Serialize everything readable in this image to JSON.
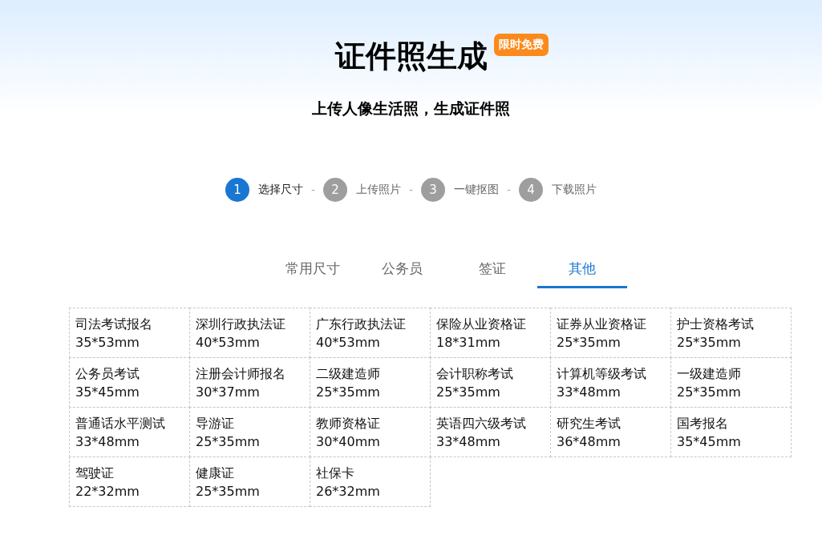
{
  "header": {
    "title": "证件照生成",
    "badge": "限时免费",
    "subtitle": "上传人像生活照，生成证件照"
  },
  "steps": [
    {
      "number": "1",
      "label": "选择尺寸",
      "selected": true,
      "separator": "-"
    },
    {
      "number": "2",
      "label": "上传照片",
      "selected": false,
      "separator": "-"
    },
    {
      "number": "3",
      "label": "一键抠图",
      "selected": false,
      "separator": "-"
    },
    {
      "number": "4",
      "label": "下载照片",
      "selected": false
    }
  ],
  "tabs": [
    {
      "label": "常用尺寸",
      "selected": false
    },
    {
      "label": "公务员",
      "selected": false
    },
    {
      "label": "签证",
      "selected": false
    },
    {
      "label": "其他",
      "selected": true
    }
  ],
  "sizes": [
    {
      "name": "司法考试报名",
      "size": "35*53mm"
    },
    {
      "name": "深圳行政执法证",
      "size": "40*53mm"
    },
    {
      "name": "广东行政执法证",
      "size": "40*53mm"
    },
    {
      "name": "保险从业资格证",
      "size": "18*31mm"
    },
    {
      "name": "证券从业资格证",
      "size": "25*35mm"
    },
    {
      "name": "护士资格考试",
      "size": "25*35mm"
    },
    {
      "name": "公务员考试",
      "size": "35*45mm"
    },
    {
      "name": "注册会计师报名",
      "size": "30*37mm"
    },
    {
      "name": "二级建造师",
      "size": "25*35mm"
    },
    {
      "name": "会计职称考试",
      "size": "25*35mm"
    },
    {
      "name": "计算机等级考试",
      "size": "33*48mm"
    },
    {
      "name": "一级建造师",
      "size": "25*35mm"
    },
    {
      "name": "普通话水平测试",
      "size": "33*48mm"
    },
    {
      "name": "导游证",
      "size": "25*35mm"
    },
    {
      "name": "教师资格证",
      "size": "30*40mm"
    },
    {
      "name": "英语四六级考试",
      "size": "33*48mm"
    },
    {
      "name": "研究生考试",
      "size": "36*48mm"
    },
    {
      "name": "国考报名",
      "size": "35*45mm"
    },
    {
      "name": "驾驶证",
      "size": "22*32mm"
    },
    {
      "name": "健康证",
      "size": "25*35mm"
    },
    {
      "name": "社保卡",
      "size": "26*32mm"
    }
  ]
}
